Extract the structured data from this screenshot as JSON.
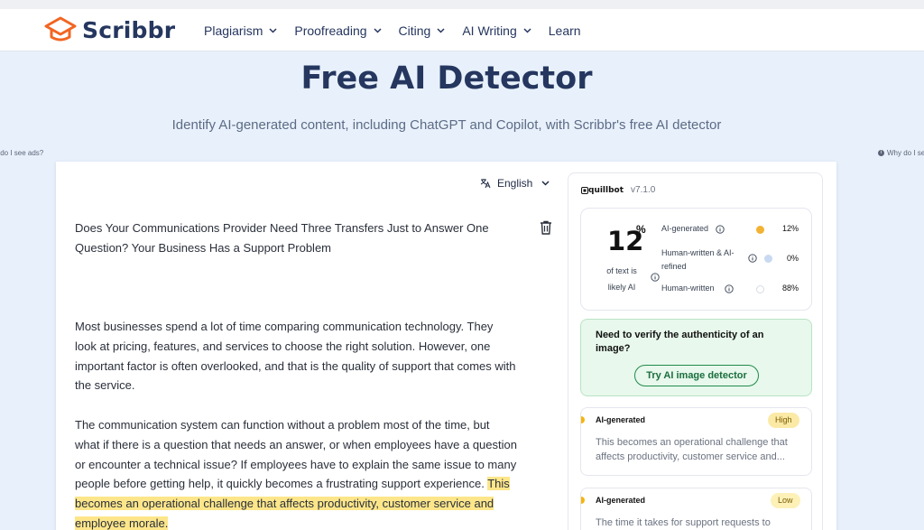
{
  "header": {
    "brand": "Scribbr",
    "nav": [
      {
        "label": "Plagiarism",
        "dropdown": true
      },
      {
        "label": "Proofreading",
        "dropdown": true
      },
      {
        "label": "Citing",
        "dropdown": true
      },
      {
        "label": "AI Writing",
        "dropdown": true
      },
      {
        "label": "Learn",
        "dropdown": false
      }
    ]
  },
  "hero": {
    "title": "Free AI Detector",
    "subtitle": "Identify AI-generated content, including ChatGPT and Copilot, with Scribbr's free AI detector"
  },
  "ads": {
    "left": "y do I see ads?",
    "right": "Why do I se"
  },
  "editor": {
    "language": "English",
    "title": "Does Your Communications Provider Need Three Transfers Just to Answer One Question? Your Business Has a Support Problem",
    "paragraph1": "Most businesses spend a lot of time comparing communication technology. They look at pricing, features, and services to choose the right solution. However, one important factor is often overlooked, and that is the quality of support that comes with the service.",
    "paragraph2_plain": "The communication system can function without a problem most of the time, but what if there is a question that needs an answer, or when employees have a question or encounter a technical issue? If employees have to explain the same issue to many people before getting help, it quickly becomes a frustrating support experience. ",
    "paragraph2_highlight": "This becomes an operational challenge that affects productivity, customer service and employee morale."
  },
  "results": {
    "provider": "quillbot",
    "version": "v7.1.0",
    "score_value": "12",
    "score_unit": "%",
    "score_caption": "of text is likely AI",
    "rows": [
      {
        "label": "AI-generated",
        "percent": "12%",
        "color": "#f2b233"
      },
      {
        "label": "Human-written & AI-refined",
        "percent": "0%",
        "color": "#c9d9f2"
      },
      {
        "label": "Human-written",
        "percent": "88%",
        "color": "#ffffff"
      }
    ],
    "verify": {
      "text": "Need to verify the authenticity of an image?",
      "button": "Try AI image detector"
    },
    "findings": [
      {
        "label": "AI-generated",
        "badge": "High",
        "badge_color": "#fbeaa6",
        "snippet": "This becomes an operational challenge that affects productivity, customer service and..."
      },
      {
        "label": "AI-generated",
        "badge": "Low",
        "badge_color": "#fdf1b8",
        "snippet": "The time it takes for support requests to"
      }
    ]
  }
}
